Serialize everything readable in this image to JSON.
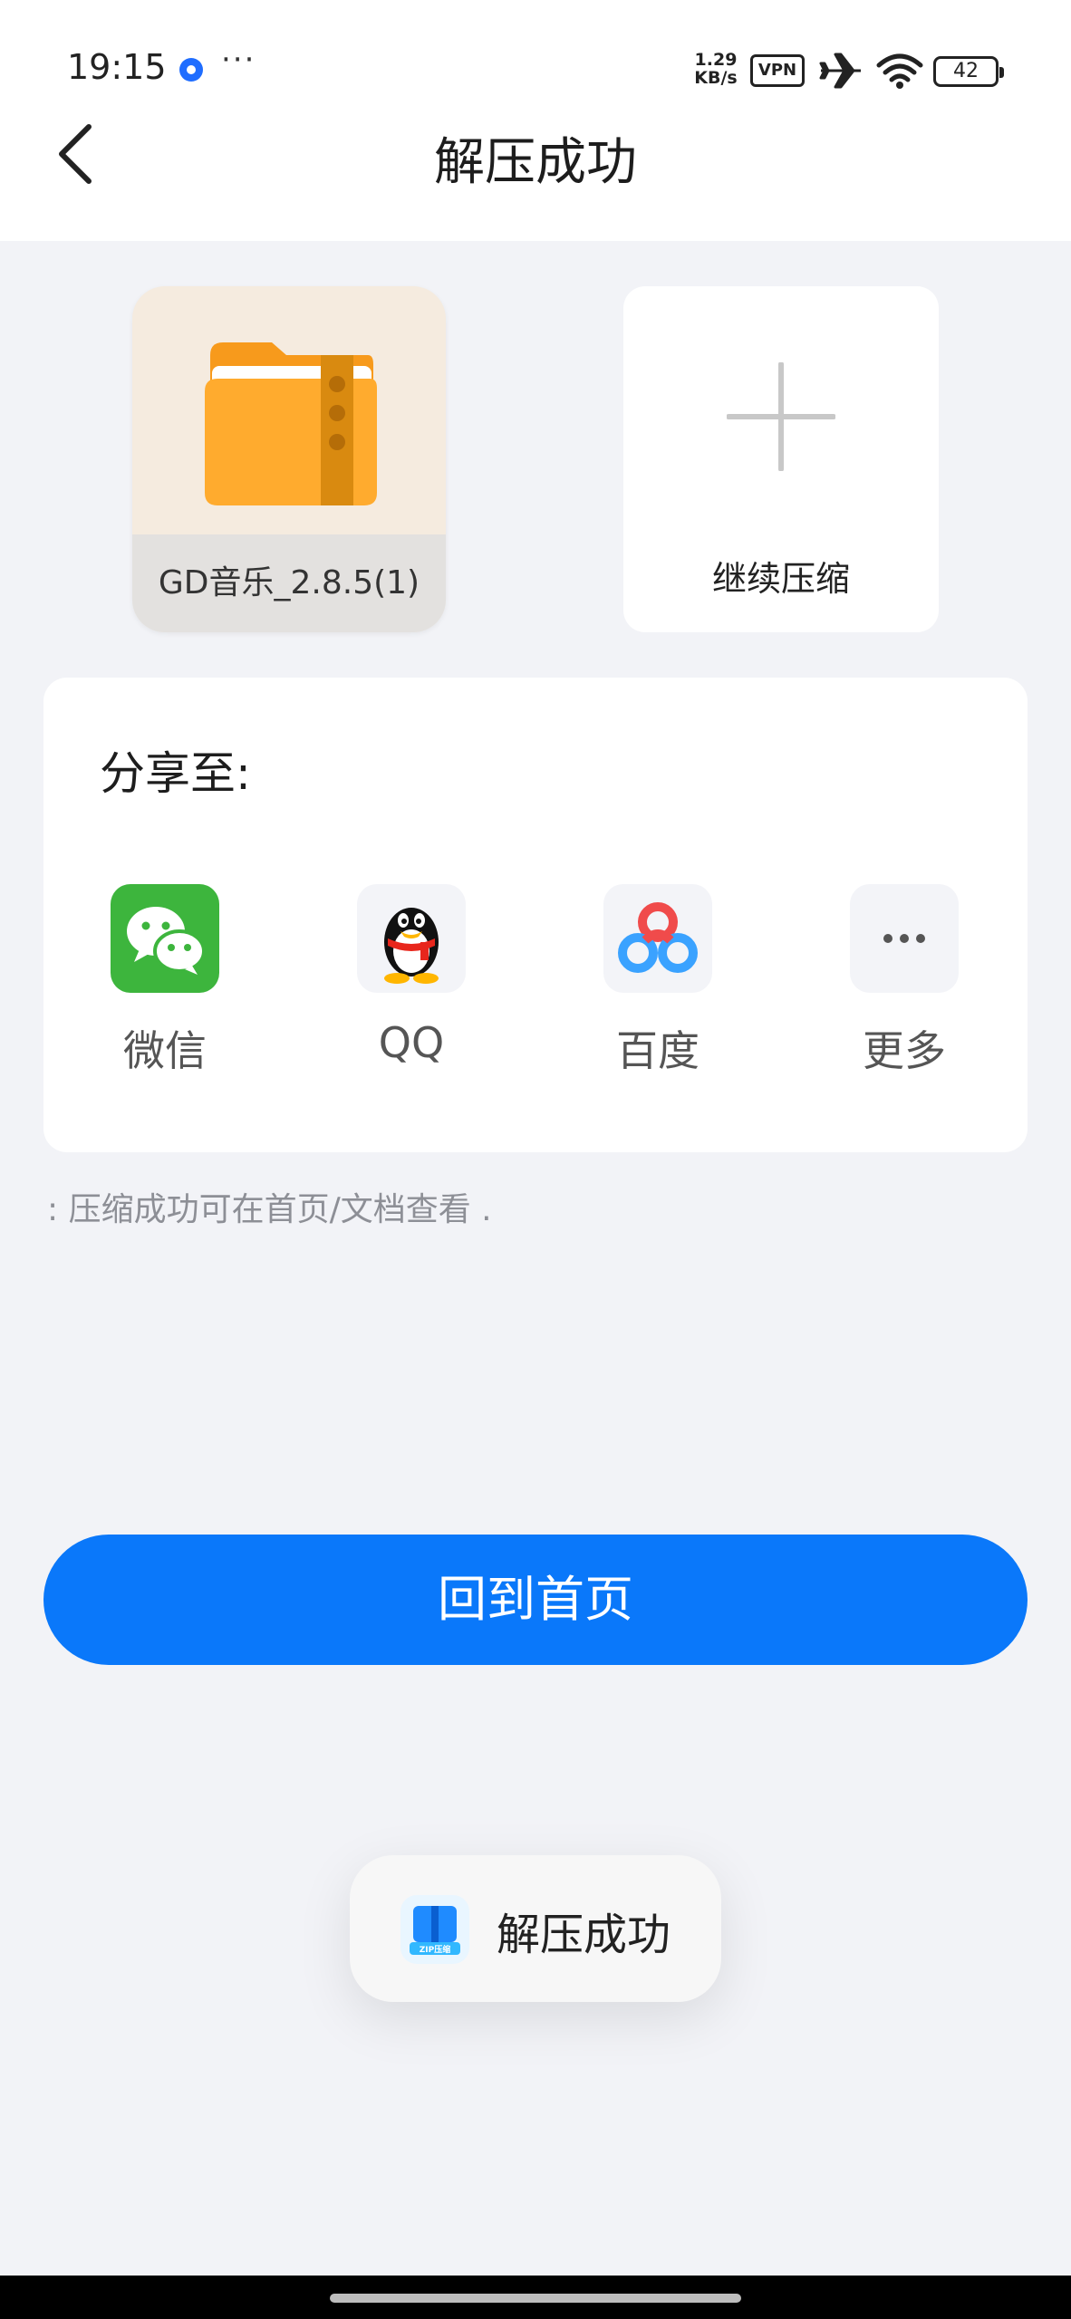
{
  "status_bar": {
    "time": "19:15",
    "more": "···",
    "net_speed_value": "1.29",
    "net_speed_unit": "KB/s",
    "vpn": "VPN",
    "battery": "42"
  },
  "header": {
    "title": "解压成功"
  },
  "file_tile": {
    "name": "GD音乐_2.8.5(1)"
  },
  "add_tile": {
    "label": "继续压缩"
  },
  "share": {
    "title": "分享至:",
    "items": [
      {
        "label": "微信",
        "icon": "wechat-icon"
      },
      {
        "label": "QQ",
        "icon": "qq-icon"
      },
      {
        "label": "百度",
        "icon": "baidu-netdisk-icon"
      },
      {
        "label": "更多",
        "icon": "more-icon"
      }
    ]
  },
  "hint": ": 压缩成功可在首页/文档查看 .",
  "home_button": {
    "label": "回到首页"
  },
  "toast": {
    "text": "解压成功",
    "icon_text": "ZIP压缩"
  },
  "colors": {
    "accent": "#0a78fa",
    "background": "#f2f3f7",
    "wechat": "#3db53d",
    "folder": "#ffa929"
  }
}
